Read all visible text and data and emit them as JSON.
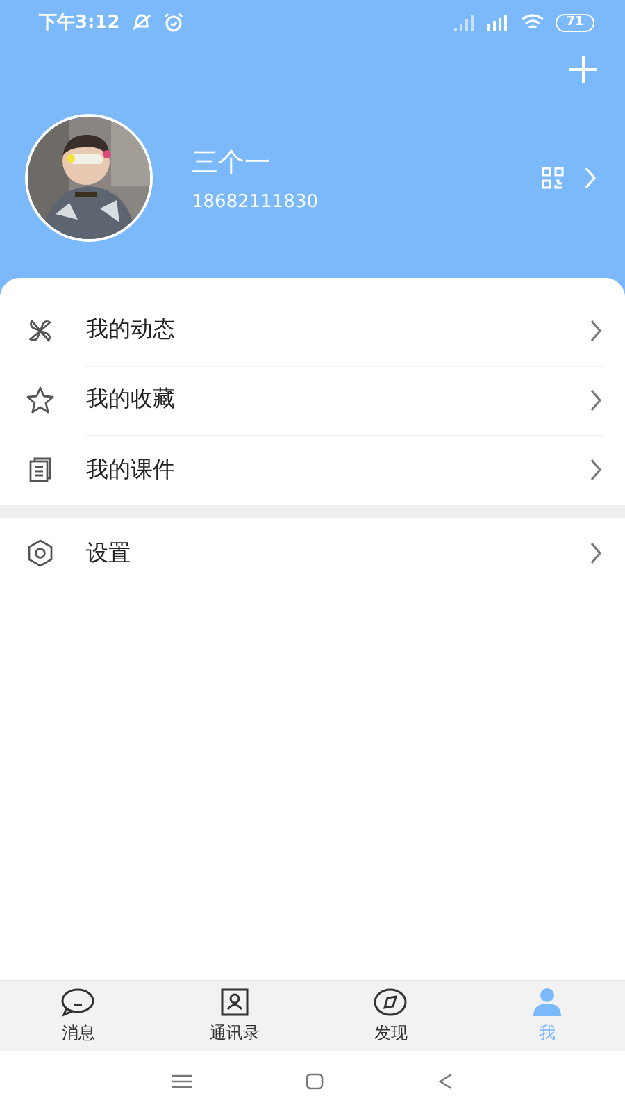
{
  "status_bar": {
    "time": "下午3:12",
    "battery": "71"
  },
  "profile": {
    "name": "三个一",
    "phone": "18682111830"
  },
  "menu_groups": [
    {
      "items": [
        {
          "kind": "pinwheel",
          "label": "我的动态"
        },
        {
          "kind": "star",
          "label": "我的收藏"
        },
        {
          "kind": "document",
          "label": "我的课件"
        }
      ]
    },
    {
      "items": [
        {
          "kind": "settings",
          "label": "设置"
        }
      ]
    }
  ],
  "tabs": [
    {
      "kind": "chat",
      "label": "消息",
      "selected": false
    },
    {
      "kind": "contact",
      "label": "通讯录",
      "selected": false
    },
    {
      "kind": "compass",
      "label": "发现",
      "selected": false
    },
    {
      "kind": "person",
      "label": "我",
      "selected": true
    }
  ]
}
